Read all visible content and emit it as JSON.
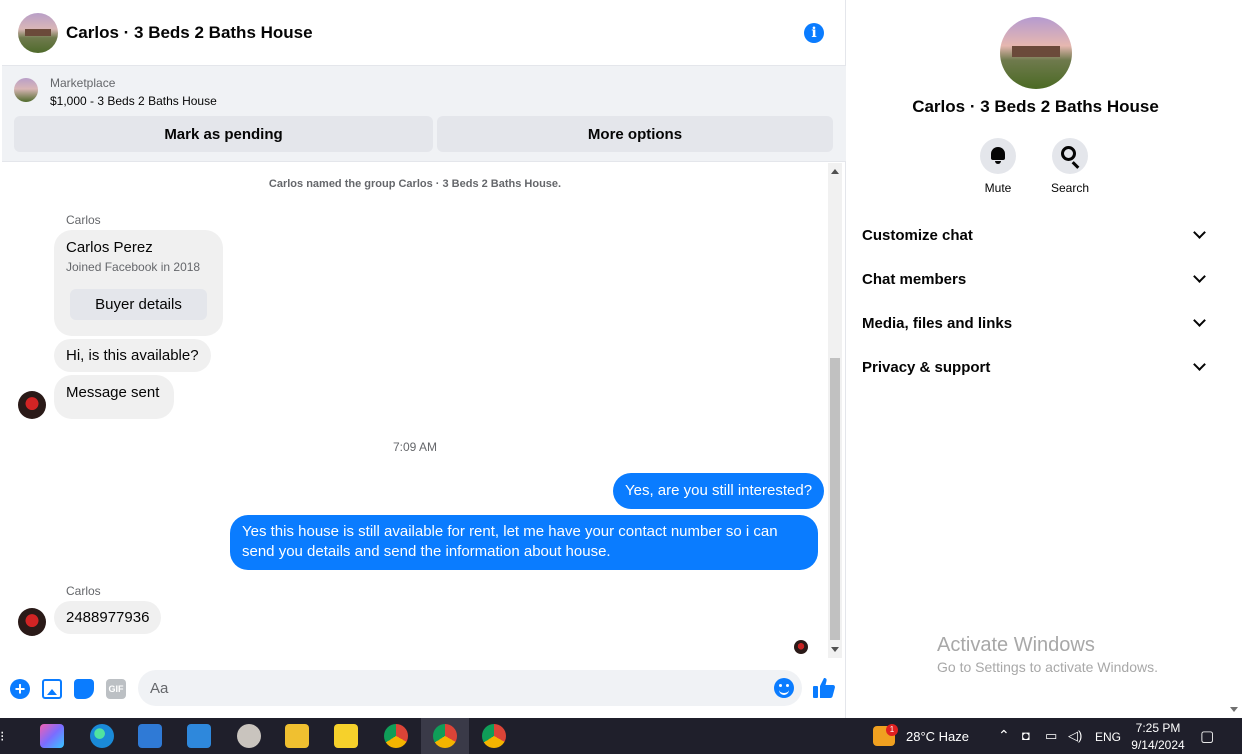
{
  "header": {
    "title": "Carlos · 3 Beds 2 Baths House",
    "info_icon": "i"
  },
  "marketplace": {
    "label": "Marketplace",
    "item": "$1,000 - 3 Beds 2 Baths House",
    "mark_pending": "Mark as pending",
    "more_options": "More options"
  },
  "messages": {
    "system_notice": "Carlos named the group Carlos · 3 Beds 2 Baths House.",
    "sender_1": "Carlos",
    "card_name": "Carlos Perez",
    "card_sub": "Joined Facebook in 2018",
    "card_button": "Buyer details",
    "msg_available": "Hi, is this available?",
    "msg_sent": "Message sent",
    "timestamp": "7:09 AM",
    "out_1": "Yes, are you still interested?",
    "out_2": "Yes this house is still available for rent, let me have your contact number so i can send you details and send the information about house.",
    "sender_2": "Carlos",
    "msg_number": "2488977936"
  },
  "composer": {
    "placeholder": "Aa",
    "gif_label": "GIF",
    "plus": "+"
  },
  "panel": {
    "title": "Carlos · 3 Beds 2 Baths House",
    "mute": "Mute",
    "search": "Search",
    "sections": [
      "Customize chat",
      "Chat members",
      "Media, files and links",
      "Privacy & support"
    ]
  },
  "watermark": {
    "title": "Activate Windows",
    "subtitle": "Go to Settings to activate Windows."
  },
  "taskbar": {
    "weather": "28°C  Haze",
    "weather_badge": "1",
    "language": "ENG",
    "time": "7:25 PM",
    "date": "9/14/2024"
  },
  "colors": {
    "accent": "#0a7cff",
    "bubble_in": "#f0f0f0",
    "taskbar": "#1f1f2b"
  }
}
